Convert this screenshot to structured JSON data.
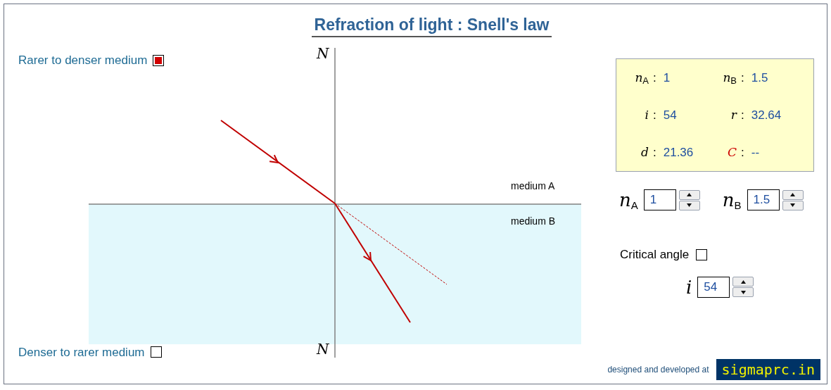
{
  "title": "Refraction of light : Snell's law",
  "modes": [
    {
      "label": "Rarer to denser medium",
      "checked": true
    },
    {
      "label": "Denser to rarer medium",
      "checked": false
    }
  ],
  "diagram": {
    "normal_labels": [
      "N",
      "N"
    ],
    "medium_labels": [
      "medium A",
      "medium B"
    ]
  },
  "readings": [
    {
      "label": "n$_{A}$",
      "separator": ":",
      "value": "1",
      "kind": "variable"
    },
    {
      "label": "n$_{B}$",
      "separator": ":",
      "value": "1.5",
      "kind": "variable"
    },
    {
      "label": "i",
      "separator": ":",
      "value": "54",
      "kind": "variable"
    },
    {
      "label": "r",
      "separator": ":",
      "value": "32.64",
      "kind": "variable"
    },
    {
      "label": "d",
      "separator": ":",
      "value": "21.36",
      "kind": "variable"
    },
    {
      "label": "C",
      "separator": ":",
      "value": "--",
      "kind": "critical"
    }
  ],
  "index_inputs": [
    {
      "label": "n$_{A}$",
      "value": "1"
    },
    {
      "label": "n$_{B}$",
      "value": "1.5"
    }
  ],
  "critical_angle": {
    "label": "Critical angle",
    "checked": false
  },
  "incidence_input": {
    "label": "i",
    "value": "54"
  },
  "footer": {
    "text": "designed and developed at",
    "logo": "sigmaprc.in"
  }
}
